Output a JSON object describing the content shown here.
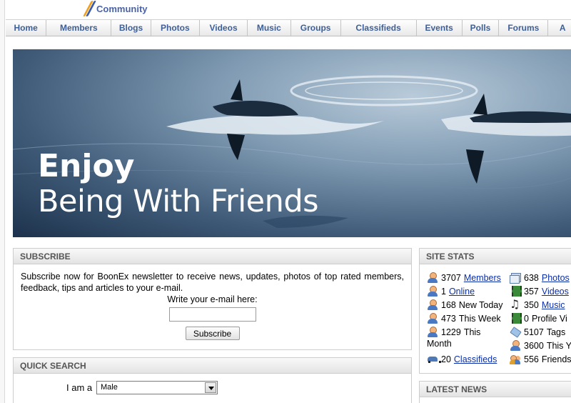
{
  "logo": {
    "text": "Community"
  },
  "nav": {
    "items": [
      {
        "label": "Home"
      },
      {
        "label": "Members"
      },
      {
        "label": "Blogs"
      },
      {
        "label": "Photos"
      },
      {
        "label": "Videos"
      },
      {
        "label": "Music"
      },
      {
        "label": "Groups"
      },
      {
        "label": "Classifieds"
      },
      {
        "label": "Events"
      },
      {
        "label": "Polls"
      },
      {
        "label": "Forums"
      },
      {
        "label": "A"
      }
    ]
  },
  "banner": {
    "title": "Enjoy",
    "subtitle": "Being With Friends"
  },
  "subscribe": {
    "heading": "SUBSCRIBE",
    "text": "Subscribe now for BoonEx newsletter to receive news, updates, photos of top rated members, feedback, tips and articles to your e-mail.",
    "prompt": "Write your e-mail here:",
    "email_value": "",
    "button_label": "Subscribe"
  },
  "quick_search": {
    "heading": "QUICK SEARCH",
    "i_am_label": "I am a",
    "i_am_value": "Male"
  },
  "site_stats": {
    "heading": "SITE STATS",
    "left": [
      {
        "icon": "member-icon",
        "count": "3707",
        "link": "Members"
      },
      {
        "icon": "online-icon",
        "count": "1",
        "link": "Online"
      },
      {
        "icon": "new-today-icon",
        "count": "168",
        "label": "New Today"
      },
      {
        "icon": "this-week-icon",
        "count": "473",
        "label": "This Week"
      },
      {
        "icon": "this-month-icon",
        "count": "1229",
        "label": "This",
        "label2": "Month"
      },
      {
        "icon": "classifieds-icon",
        "count": "20",
        "link": "Classifieds"
      }
    ],
    "right": [
      {
        "icon": "photos-icon",
        "count": "638",
        "link": "Photos"
      },
      {
        "icon": "videos-icon",
        "count": "357",
        "link": "Videos"
      },
      {
        "icon": "music-icon",
        "count": "350",
        "link": "Music"
      },
      {
        "icon": "profile-views-icon",
        "count": "0",
        "label": "Profile Vi"
      },
      {
        "icon": "tags-icon",
        "count": "5107",
        "label": "Tags"
      },
      {
        "icon": "this-year-icon",
        "count": "3600",
        "label": "This Y"
      },
      {
        "icon": "friends-icon",
        "count": "556",
        "label": "Friends"
      }
    ]
  },
  "latest_news": {
    "heading": "LATEST NEWS"
  }
}
